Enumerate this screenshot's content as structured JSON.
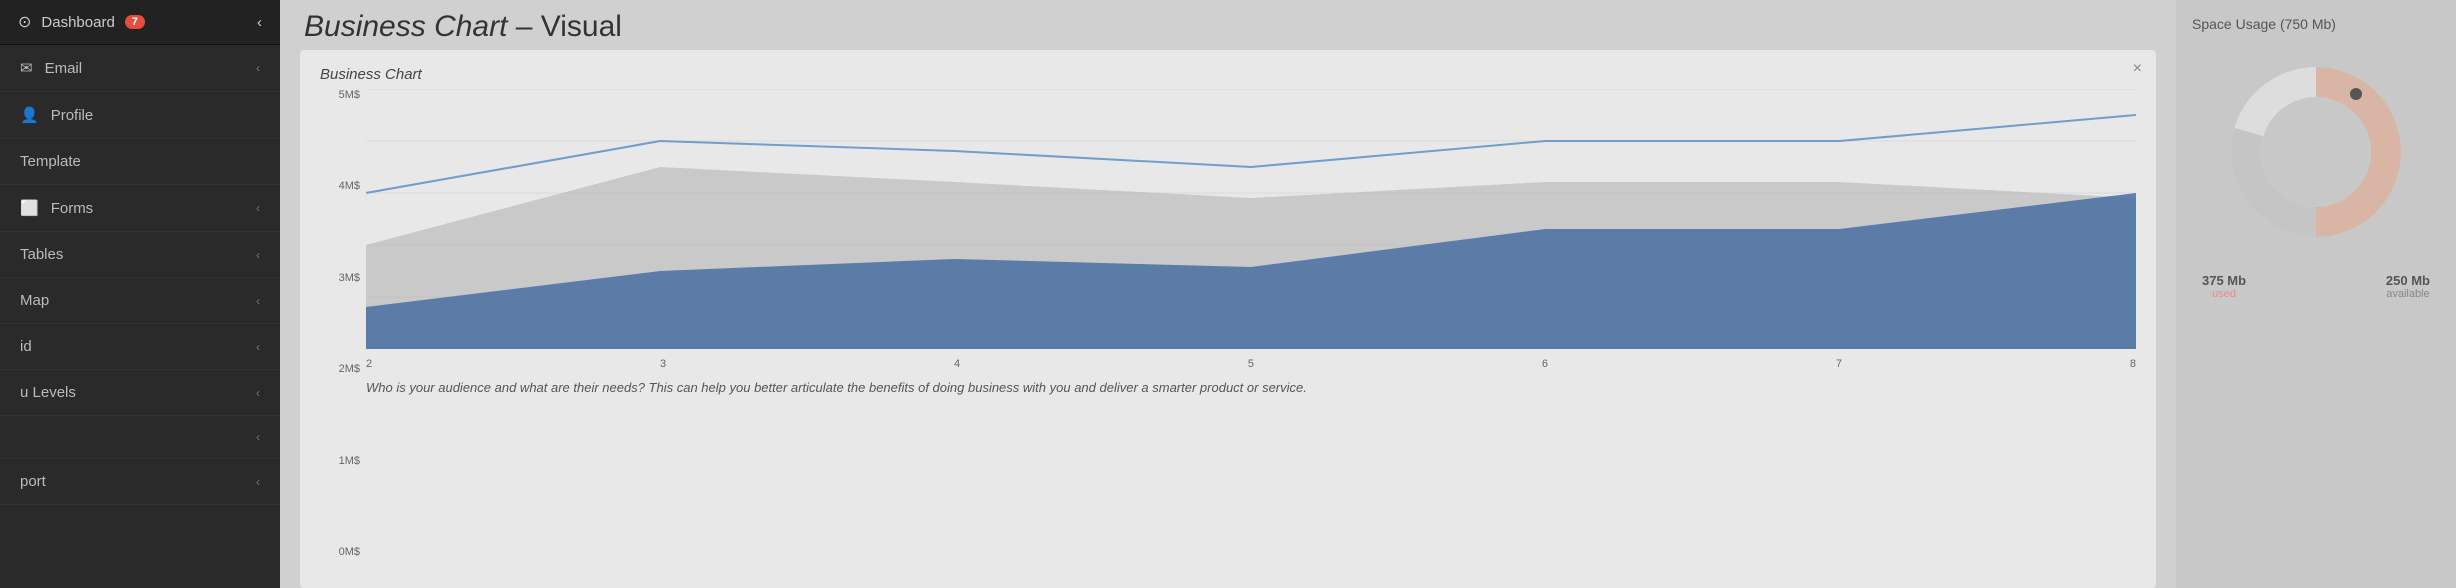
{
  "sidebar": {
    "items": [
      {
        "id": "dashboard",
        "icon": "⊙",
        "label": "Dashboard",
        "badge": "7",
        "hasChevron": true
      },
      {
        "id": "email",
        "icon": "✉",
        "label": "Email",
        "hasChevron": true
      },
      {
        "id": "profile",
        "icon": "👤",
        "label": "Profile",
        "hasChevron": false
      },
      {
        "id": "template",
        "icon": "",
        "label": "Template",
        "hasChevron": false
      },
      {
        "id": "forms",
        "icon": "⬜",
        "label": "Forms",
        "hasChevron": true
      },
      {
        "id": "tables",
        "icon": "",
        "label": "Tables",
        "hasChevron": true
      },
      {
        "id": "map",
        "icon": "",
        "label": "Map",
        "hasChevron": true
      },
      {
        "id": "id",
        "icon": "",
        "label": "id",
        "hasChevron": true
      },
      {
        "id": "ulevels",
        "icon": "",
        "label": "u Levels",
        "hasChevron": true
      },
      {
        "id": "blank",
        "icon": "",
        "label": "",
        "hasChevron": true
      },
      {
        "id": "port",
        "icon": "",
        "label": "port",
        "hasChevron": true
      }
    ]
  },
  "page": {
    "title_italic": "Business Chart",
    "title_regular": " – Visual"
  },
  "chart": {
    "title": "Business Chart",
    "close_label": "×",
    "y_labels": [
      "5M$",
      "4M$",
      "3M$",
      "2M$",
      "1M$",
      "0M$"
    ],
    "x_labels": [
      "2",
      "3",
      "4",
      "5",
      "6",
      "7",
      "8"
    ],
    "description": "Who is your audience and what are their needs? This can help you better articulate the benefits of doing business\nwith you and deliver a smarter product or service."
  },
  "space_usage": {
    "title": "Space Usage (750 Mb)",
    "used_amount": "375 Mb",
    "used_label": "used",
    "available_amount": "250 Mb",
    "available_label": "available"
  }
}
